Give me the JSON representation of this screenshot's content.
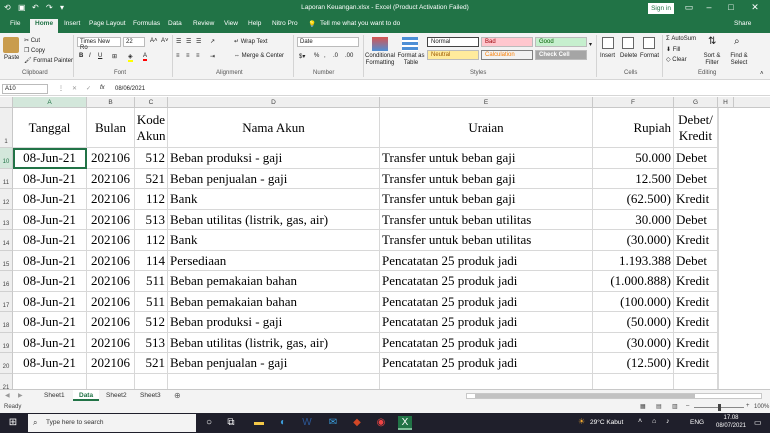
{
  "titlebar": {
    "title": "Laporan Keuangan.xlsx  -  Excel (Product Activation Failed)",
    "search": "Tell me what you want to do",
    "signin": "Sign in",
    "share": "Share",
    "autosave_icon": "save-icon"
  },
  "tabs": [
    "File",
    "Home",
    "Insert",
    "Page Layout",
    "Formulas",
    "Data",
    "Review",
    "View",
    "Help",
    "Nitro Pro"
  ],
  "ribbon": {
    "clipboard": {
      "paste": "Paste",
      "cut": "Cut",
      "copy": "Copy",
      "format_painter": "Format Painter",
      "group": "Clipboard"
    },
    "font": {
      "name": "Times New Ro",
      "size": "22",
      "group": "Font"
    },
    "alignment": {
      "wrap": "Wrap Text",
      "merge": "Merge & Center",
      "group": "Alignment"
    },
    "number": {
      "format": "Date",
      "group": "Number"
    },
    "styles": {
      "conditional": "Conditional Formatting",
      "format_table": "Format as Table",
      "normal": "Normal",
      "bad": "Bad",
      "good": "Good",
      "neutral": "Neutral",
      "calculation": "Calculation",
      "check_cell": "Check Cell",
      "group": "Styles"
    },
    "cells": {
      "insert": "Insert",
      "delete": "Delete",
      "format": "Format",
      "group": "Cells"
    },
    "editing": {
      "autosum": "AutoSum",
      "fill": "Fill",
      "clear": "Clear",
      "sort": "Sort & Filter",
      "find": "Find & Select",
      "group": "Editing"
    }
  },
  "formula_bar": {
    "name_box": "A10",
    "fx": "fx",
    "value": "08/06/2021"
  },
  "columns": [
    "A",
    "B",
    "C",
    "D",
    "E",
    "F",
    "G",
    "H"
  ],
  "header_row": {
    "row": "1",
    "cells": [
      "Tanggal",
      "Bulan",
      "Kode Akun",
      "Nama Akun",
      "Uraian",
      "Rupiah",
      "Debet/ Kredit"
    ]
  },
  "rows": [
    {
      "row": "10",
      "cells": [
        "08-Jun-21",
        "202106",
        "512",
        "Beban produksi - gaji",
        "Transfer untuk beban gaji",
        "50.000",
        "Debet"
      ]
    },
    {
      "row": "11",
      "cells": [
        "08-Jun-21",
        "202106",
        "521",
        "Beban penjualan - gaji",
        "Transfer untuk beban gaji",
        "12.500",
        "Debet"
      ]
    },
    {
      "row": "12",
      "cells": [
        "08-Jun-21",
        "202106",
        "112",
        "Bank",
        "Transfer untuk beban gaji",
        "(62.500)",
        "Kredit"
      ]
    },
    {
      "row": "13",
      "cells": [
        "08-Jun-21",
        "202106",
        "513",
        "Beban utilitas (listrik, gas, air)",
        "Transfer untuk beban utilitas",
        "30.000",
        "Debet"
      ]
    },
    {
      "row": "14",
      "cells": [
        "08-Jun-21",
        "202106",
        "112",
        "Bank",
        "Transfer untuk beban utilitas",
        "(30.000)",
        "Kredit"
      ]
    },
    {
      "row": "15",
      "cells": [
        "08-Jun-21",
        "202106",
        "114",
        "Persediaan",
        "Pencatatan 25 produk jadi",
        "1.193.388",
        "Debet"
      ]
    },
    {
      "row": "16",
      "cells": [
        "08-Jun-21",
        "202106",
        "511",
        "Beban pemakaian bahan",
        "Pencatatan 25 produk jadi",
        "(1.000.888)",
        "Kredit"
      ]
    },
    {
      "row": "17",
      "cells": [
        "08-Jun-21",
        "202106",
        "511",
        "Beban pemakaian bahan",
        "Pencatatan 25 produk jadi",
        "(100.000)",
        "Kredit"
      ]
    },
    {
      "row": "18",
      "cells": [
        "08-Jun-21",
        "202106",
        "512",
        "Beban produksi - gaji",
        "Pencatatan 25 produk jadi",
        "(50.000)",
        "Kredit"
      ]
    },
    {
      "row": "19",
      "cells": [
        "08-Jun-21",
        "202106",
        "513",
        "Beban utilitas (listrik, gas, air)",
        "Pencatatan 25 produk jadi",
        "(30.000)",
        "Kredit"
      ]
    },
    {
      "row": "20",
      "cells": [
        "08-Jun-21",
        "202106",
        "521",
        "Beban penjualan - gaji",
        "Pencatatan 25 produk jadi",
        "(12.500)",
        "Kredit"
      ]
    },
    {
      "row": "21",
      "cells": [
        "",
        "",
        "",
        "",
        "",
        "",
        ""
      ]
    }
  ],
  "sheets": [
    "Sheet1",
    "Data",
    "Sheet2",
    "Sheet3"
  ],
  "active_sheet": "Data",
  "status": {
    "left": "Ready",
    "zoom": "100%"
  },
  "taskbar": {
    "search": "Type here to search",
    "weather": "29°C Kabut",
    "lang": "ENG",
    "time": "17.08",
    "date": "08/07/2021"
  },
  "colors": {
    "excel_green": "#217346",
    "taskbar": "#1f1f2b"
  }
}
